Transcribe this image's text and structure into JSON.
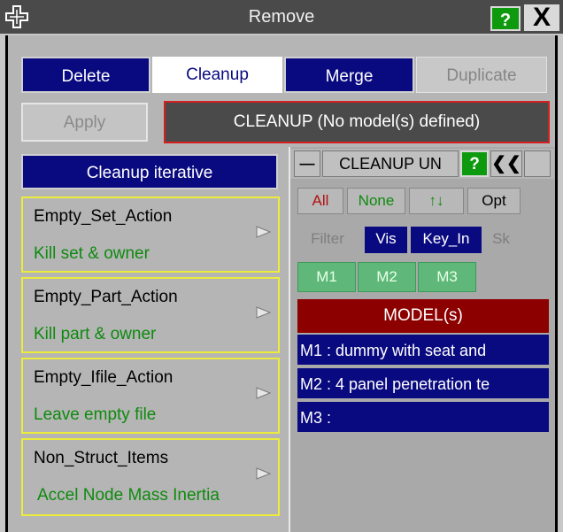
{
  "window": {
    "title": "Remove",
    "help_label": "?",
    "close_label": "X"
  },
  "tabs": [
    {
      "label": "Delete",
      "state": "normal"
    },
    {
      "label": "Cleanup",
      "state": "selected"
    },
    {
      "label": "Merge",
      "state": "normal"
    },
    {
      "label": "Duplicate",
      "state": "disabled"
    }
  ],
  "apply_label": "Apply",
  "status_text": "CLEANUP (No model(s) defined)",
  "cleanup_iterative_label": "Cleanup iterative",
  "actions": [
    {
      "name": "Empty_Set_Action",
      "value": "Kill set & owner"
    },
    {
      "name": "Empty_Part_Action",
      "value": "Kill part & owner"
    },
    {
      "name": "Empty_Ifile_Action",
      "value": "Leave empty file"
    },
    {
      "name": "Non_Struct_Items",
      "value": "Accel Node Mass Inertia"
    }
  ],
  "model_panel": {
    "title": "CLEANUP UN",
    "help_label": "?",
    "collapse_label": "❮❮",
    "minimize_label": "—",
    "buttons": {
      "all": "All",
      "none": "None",
      "sort": "↑↓",
      "opt": "Opt",
      "filter": "Filter",
      "vis": "Vis",
      "key_in": "Key_In",
      "sk": "Sk"
    },
    "model_tabs": [
      "M1",
      "M2",
      "M3"
    ],
    "header": "MODEL(s)",
    "models": [
      "M1 : dummy with seat and",
      "M2 : 4 panel penetration te",
      "M3 :"
    ]
  },
  "colors": {
    "dark_blue": "#0a0a80",
    "green_text": "#0e8a0e",
    "model_header": "#8c0000",
    "status_border": "#d42020",
    "action_border": "#ecec3a"
  }
}
